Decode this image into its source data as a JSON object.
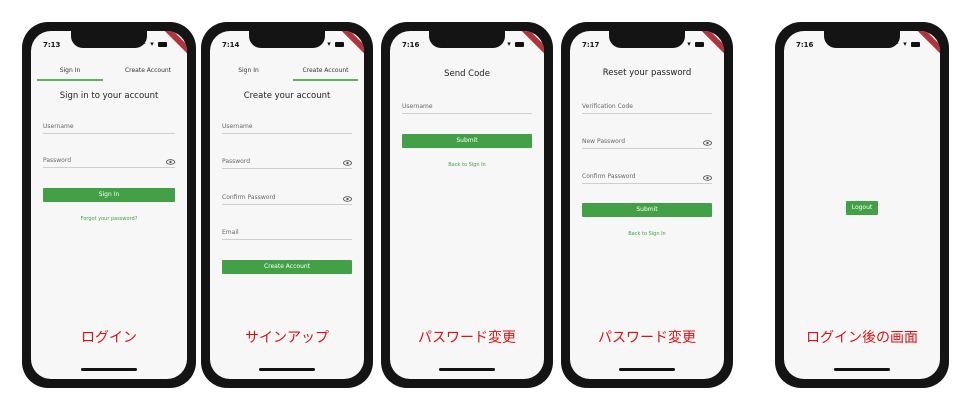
{
  "screens": {
    "signin": {
      "time": "7:13",
      "tabs": [
        "Sign In",
        "Create Account"
      ],
      "title": "Sign in to your account",
      "username_label": "Username",
      "password_label": "Password",
      "button": "Sign In",
      "link": "Forgot your password?",
      "caption": "ログイン"
    },
    "signup": {
      "time": "7:14",
      "tabs": [
        "Sign In",
        "Create Account"
      ],
      "title": "Create your account",
      "username_label": "Username",
      "password_label": "Password",
      "confirm_label": "Confirm Password",
      "email_label": "Email",
      "button": "Create Account",
      "caption": "サインアップ"
    },
    "sendcode": {
      "time": "7:16",
      "title": "Send Code",
      "username_label": "Username",
      "button": "Submit",
      "link": "Back to Sign In",
      "caption": "パスワード変更"
    },
    "reset": {
      "time": "7:17",
      "title": "Reset your password",
      "verification_label": "Verification Code",
      "new_password_label": "New Password",
      "confirm_label": "Confirm Password",
      "button": "Submit",
      "link": "Back to Sign In",
      "caption": "パスワード変更"
    },
    "loggedin": {
      "time": "7:16",
      "button": "Logout",
      "caption": "ログイン後の画面"
    }
  },
  "colors": {
    "accent": "#43a047",
    "caption": "#e01010",
    "frame": "#141414"
  }
}
